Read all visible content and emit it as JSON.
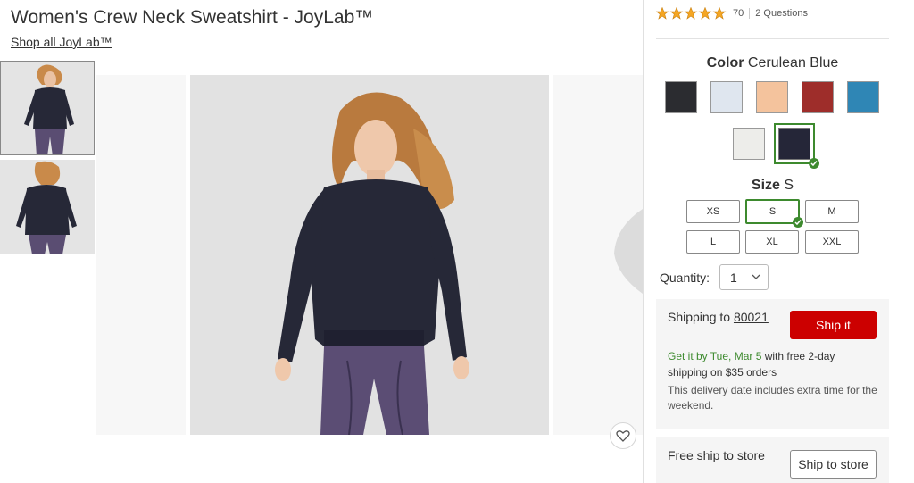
{
  "product": {
    "title": "Women's Crew Neck Sweatshirt - JoyLab™",
    "shop_all_label": "Shop all JoyLab™"
  },
  "rating": {
    "stars": 5,
    "count": "70",
    "questions_label": "2 Questions"
  },
  "color": {
    "label": "Color",
    "selected": "Cerulean Blue",
    "swatches": [
      {
        "name": "black",
        "hex": "#2b2c30"
      },
      {
        "name": "light-blue",
        "hex": "#dfe6ef"
      },
      {
        "name": "peach",
        "hex": "#f4c39d"
      },
      {
        "name": "red",
        "hex": "#9e2d2a"
      },
      {
        "name": "cerulean",
        "hex": "#2f86b5"
      },
      {
        "name": "cream",
        "hex": "#ededea"
      },
      {
        "name": "navy",
        "hex": "#252638"
      }
    ],
    "accent_green": "#3d8a2e"
  },
  "size": {
    "label": "Size",
    "selected": "S",
    "options": [
      "XS",
      "S",
      "M",
      "L",
      "XL",
      "XXL"
    ]
  },
  "quantity": {
    "label": "Quantity:",
    "value": "1"
  },
  "shipping": {
    "ship_to_label": "Shipping to",
    "zip": "80021",
    "ship_button": "Ship it",
    "date_prefix": "Get it by Tue, Mar 5",
    "date_suffix": " with free 2-day shipping on $35 orders",
    "note": "This delivery date includes extra time for the weekend."
  },
  "store": {
    "label": "Free ship to store",
    "button": "Ship to store"
  },
  "colors": {
    "ship_red": "#cc0000",
    "star_gold": "#f5a623"
  }
}
